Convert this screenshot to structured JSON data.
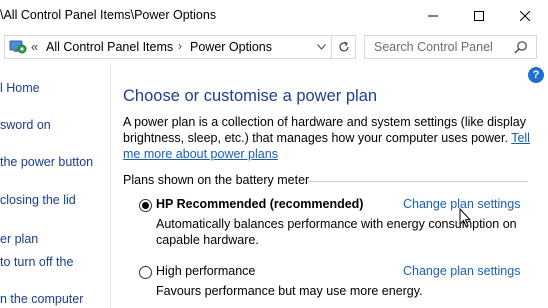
{
  "window": {
    "title": "\\All Control Panel Items\\Power Options"
  },
  "addressbar": {
    "crumbs": [
      "All Control Panel Items",
      "Power Options"
    ],
    "search_placeholder": "Search Control Panel"
  },
  "sidebar": {
    "items": [
      {
        "label": "l Home"
      },
      {
        "label": "sword on"
      },
      {
        "label": "the power button"
      },
      {
        "label": "closing the lid"
      },
      {
        "label": "er plan"
      },
      {
        "label": " to turn off the"
      },
      {
        "label": "n the computer"
      }
    ]
  },
  "main": {
    "heading": "Choose or customise a power plan",
    "description": "A power plan is a collection of hardware and system settings (like display brightness, sleep, etc.) that manages how your computer uses power.",
    "description_link": "Tell me more about power plans",
    "section_label": "Plans shown on the battery meter",
    "plans": [
      {
        "name": "HP Recommended (recommended)",
        "selected": true,
        "change_label": "Change plan settings",
        "description": "Automatically balances performance with energy consumption on capable hardware."
      },
      {
        "name": "High performance",
        "selected": false,
        "change_label": "Change plan settings",
        "description": "Favours performance but may use more energy."
      }
    ]
  },
  "colors": {
    "link": "#1a5fb4",
    "heading": "#1e3f8f",
    "help": "#1e6fd0"
  },
  "icons": {
    "minimize": "minimize-icon",
    "maximize": "maximize-icon",
    "close": "close-icon",
    "control_panel": "control-panel-icon",
    "refresh": "refresh-icon",
    "search": "search-icon",
    "help": "help-icon",
    "cursor": "mouse-cursor-icon"
  }
}
